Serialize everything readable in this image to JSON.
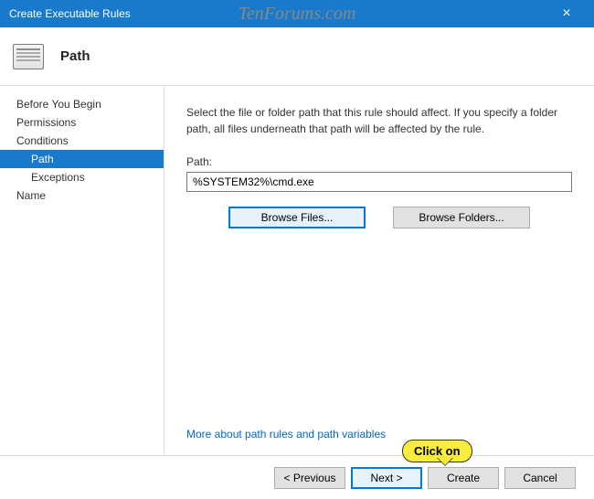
{
  "window": {
    "title": "Create Executable Rules"
  },
  "watermark": "TenForums.com",
  "header": {
    "title": "Path"
  },
  "sidebar": {
    "items": [
      {
        "label": "Before You Begin",
        "selected": false,
        "sub": false
      },
      {
        "label": "Permissions",
        "selected": false,
        "sub": false
      },
      {
        "label": "Conditions",
        "selected": false,
        "sub": false
      },
      {
        "label": "Path",
        "selected": true,
        "sub": true
      },
      {
        "label": "Exceptions",
        "selected": false,
        "sub": true
      },
      {
        "label": "Name",
        "selected": false,
        "sub": false
      }
    ]
  },
  "main": {
    "description": "Select the file or folder path that this rule should affect. If you specify a folder path, all files underneath that path will be affected by the rule.",
    "path_label": "Path:",
    "path_value": "%SYSTEM32%\\cmd.exe",
    "browse_files": "Browse Files...",
    "browse_folders": "Browse Folders...",
    "help_link": "More about path rules and path variables"
  },
  "footer": {
    "previous": "< Previous",
    "next": "Next >",
    "create": "Create",
    "cancel": "Cancel"
  },
  "callout": {
    "text": "Click on"
  }
}
